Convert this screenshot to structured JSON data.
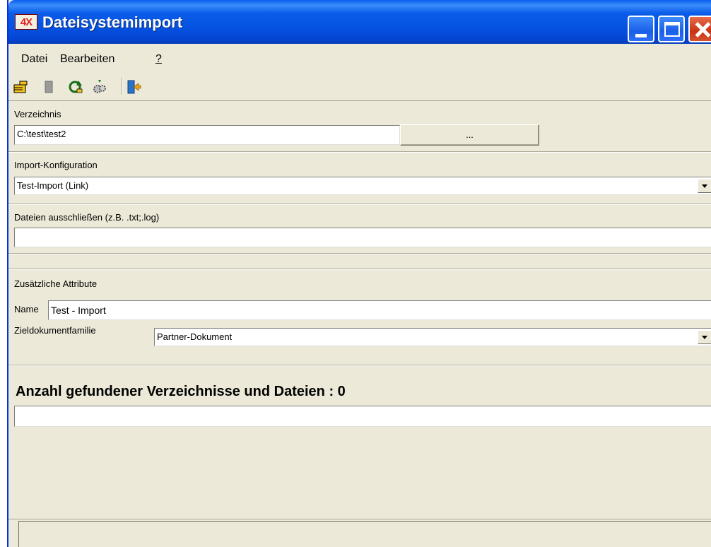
{
  "window": {
    "title": "Dateisystemimport",
    "icon_text": "4X"
  },
  "menu": {
    "items": [
      "Datei",
      "Bearbeiten",
      "?"
    ]
  },
  "toolbar": {
    "icons": [
      "hand-pointer-icon",
      "document-icon",
      "refresh-icon",
      "settings-gears-icon",
      "exit-door-icon"
    ]
  },
  "form": {
    "directory": {
      "label": "Verzeichnis",
      "value": "C:\\test\\test2",
      "browse_label": "..."
    },
    "import_config": {
      "label": "Import-Konfiguration",
      "value": "Test-Import (Link)"
    },
    "exclude": {
      "label": "Dateien ausschließen (z.B. .txt;.log)",
      "value": ""
    },
    "additional": {
      "label": "Zusätzliche Attribute",
      "name_label": "Name",
      "name_value": "Test - Import",
      "family_label": "Zieldokumentfamilie",
      "family_value": "Partner-Dokument"
    }
  },
  "result": {
    "count_label": "Anzahl gefundener Verzeichnisse und Dateien : 0",
    "value": ""
  },
  "colors": {
    "titlebar": "#0551e0",
    "window_bg": "#ece9d8",
    "close": "#c83413"
  }
}
